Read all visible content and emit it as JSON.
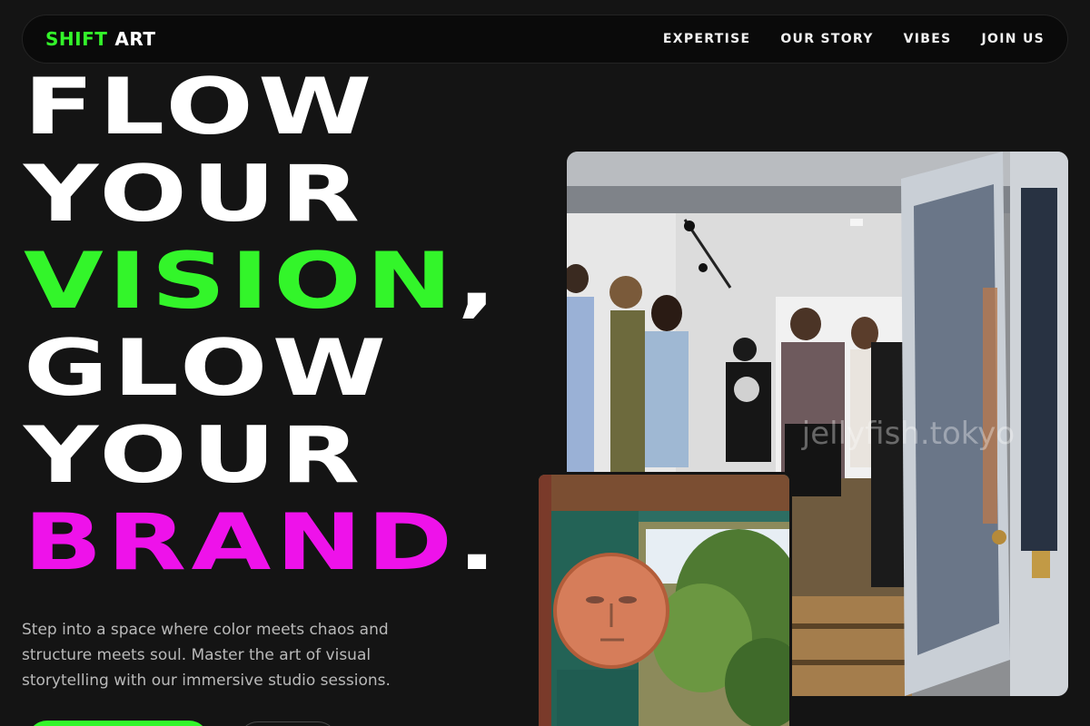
{
  "brand": {
    "logo_part1": "SHIFT",
    "logo_part2": "ART",
    "accent_green": "#33f52a",
    "accent_magenta": "#ee12ea"
  },
  "nav": {
    "items": [
      {
        "label": "EXPERTISE"
      },
      {
        "label": "OUR STORY"
      },
      {
        "label": "VIBES"
      },
      {
        "label": "JOIN US"
      }
    ]
  },
  "hero": {
    "line1": "FLOW",
    "line2": "YOUR",
    "line3_highlight": "VISION",
    "line3_punct": ",",
    "line4": "GLOW",
    "line5": "YOUR",
    "line6_highlight": "BRAND",
    "line6_punct": ".",
    "description": "Step into a space where color meets chaos and structure meets soul. Master the art of visual storytelling with our immersive studio sessions."
  },
  "images": {
    "gallery_watermark": "jellyfish.tokyo",
    "gallery_icon": "photo-gallery-opening",
    "mural_icon": "photo-moon-mural"
  }
}
